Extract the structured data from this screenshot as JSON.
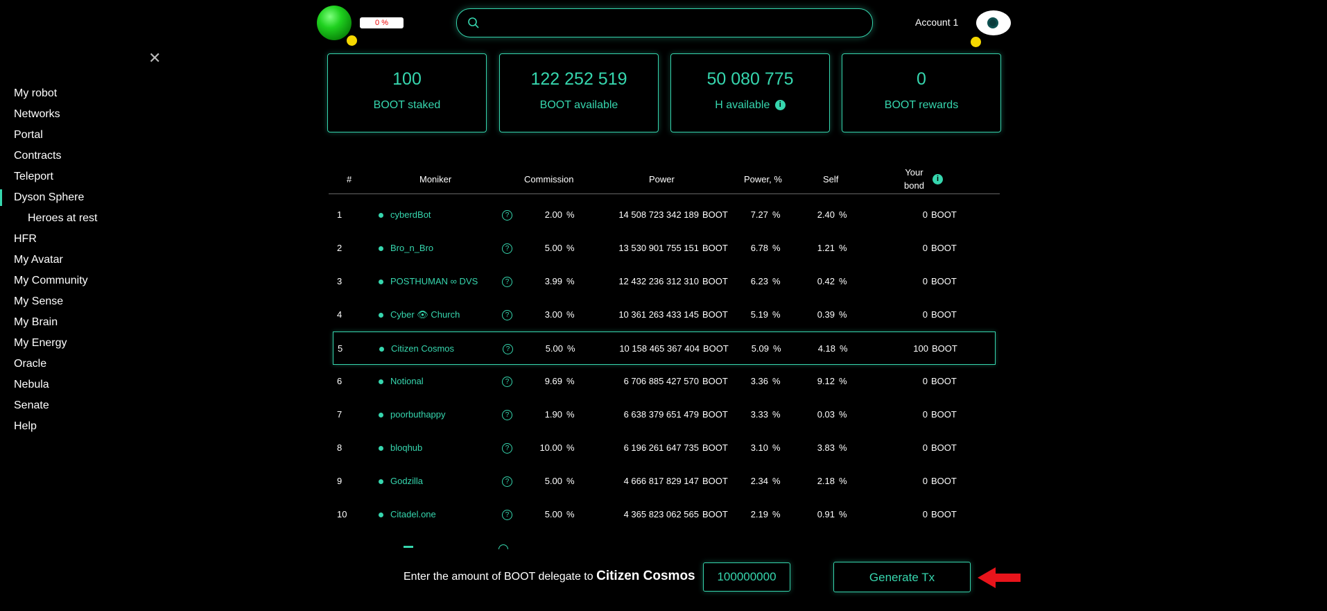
{
  "header": {
    "progress_label": "0 %",
    "progress_value": 0,
    "search_placeholder": "",
    "account_label": "Account 1"
  },
  "sidebar": {
    "items": [
      {
        "label": "My robot"
      },
      {
        "label": "Networks"
      },
      {
        "label": "Portal"
      },
      {
        "label": "Contracts"
      },
      {
        "label": "Teleport"
      },
      {
        "label": "Dyson Sphere",
        "active": true
      },
      {
        "label": "Heroes at rest",
        "sub": true
      },
      {
        "label": "HFR"
      },
      {
        "label": "My Avatar"
      },
      {
        "label": "My Community"
      },
      {
        "label": "My Sense"
      },
      {
        "label": "My Brain"
      },
      {
        "label": "My Energy"
      },
      {
        "label": "Oracle"
      },
      {
        "label": "Nebula"
      },
      {
        "label": "Senate"
      },
      {
        "label": "Help"
      }
    ]
  },
  "cards": [
    {
      "value": "100",
      "label": "BOOT staked"
    },
    {
      "value": "122 252 519",
      "label": "BOOT available"
    },
    {
      "value": "50 080 775",
      "label": "H available",
      "info": "i"
    },
    {
      "value": "0",
      "label": "BOOT rewards"
    }
  ],
  "table": {
    "headers": {
      "num": "#",
      "moniker": "Moniker",
      "commission": "Commission",
      "power": "Power",
      "power_pct": "Power, %",
      "self": "Self",
      "bond_line1": "Your",
      "bond_line2": "bond",
      "bond_info": "i"
    },
    "help_glyph": "?",
    "pct_unit": "%",
    "boot_unit": "BOOT",
    "rows": [
      {
        "n": "1",
        "moniker": "cyberdBot",
        "commission": "2.00",
        "power": "14 508 723 342 189",
        "power_pct": "7.27",
        "self": "2.40",
        "bond": "0"
      },
      {
        "n": "2",
        "moniker": "Bro_n_Bro",
        "commission": "5.00",
        "power": "13 530 901 755 151",
        "power_pct": "6.78",
        "self": "1.21",
        "bond": "0"
      },
      {
        "n": "3",
        "moniker": "POSTHUMAN ∞ DVS",
        "commission": "3.99",
        "power": "12 432 236 312 310",
        "power_pct": "6.23",
        "self": "0.42",
        "bond": "0"
      },
      {
        "n": "4",
        "moniker": "Cyber 👁 Church",
        "commission": "3.00",
        "power": "10 361 263 433 145",
        "power_pct": "5.19",
        "self": "0.39",
        "bond": "0"
      },
      {
        "n": "5",
        "moniker": "Citizen Cosmos",
        "commission": "5.00",
        "power": "10 158 465 367 404",
        "power_pct": "5.09",
        "self": "4.18",
        "bond": "100",
        "selected": true
      },
      {
        "n": "6",
        "moniker": "Notional",
        "commission": "9.69",
        "power": "6 706 885 427 570",
        "power_pct": "3.36",
        "self": "9.12",
        "bond": "0"
      },
      {
        "n": "7",
        "moniker": "poorbuthappy",
        "commission": "1.90",
        "power": "6 638 379 651 479",
        "power_pct": "3.33",
        "self": "0.03",
        "bond": "0"
      },
      {
        "n": "8",
        "moniker": "bloqhub",
        "commission": "10.00",
        "power": "6 196 261 647 735",
        "power_pct": "3.10",
        "self": "3.83",
        "bond": "0"
      },
      {
        "n": "9",
        "moniker": "Godzilla",
        "commission": "5.00",
        "power": "4 666 817 829 147",
        "power_pct": "2.34",
        "self": "2.18",
        "bond": "0"
      },
      {
        "n": "10",
        "moniker": "Citadel.one",
        "commission": "5.00",
        "power": "4 365 823 062 565",
        "power_pct": "2.19",
        "self": "0.91",
        "bond": "0"
      }
    ]
  },
  "delegate": {
    "prompt": "Enter the amount of BOOT delegate to",
    "target": "Citizen Cosmos",
    "amount_value": "100000000",
    "button_label": "Generate Tx"
  },
  "colors": {
    "accent": "#36d6ae",
    "background": "#000000",
    "arrow": "#e8141b",
    "status_dot": "#f5d800"
  }
}
